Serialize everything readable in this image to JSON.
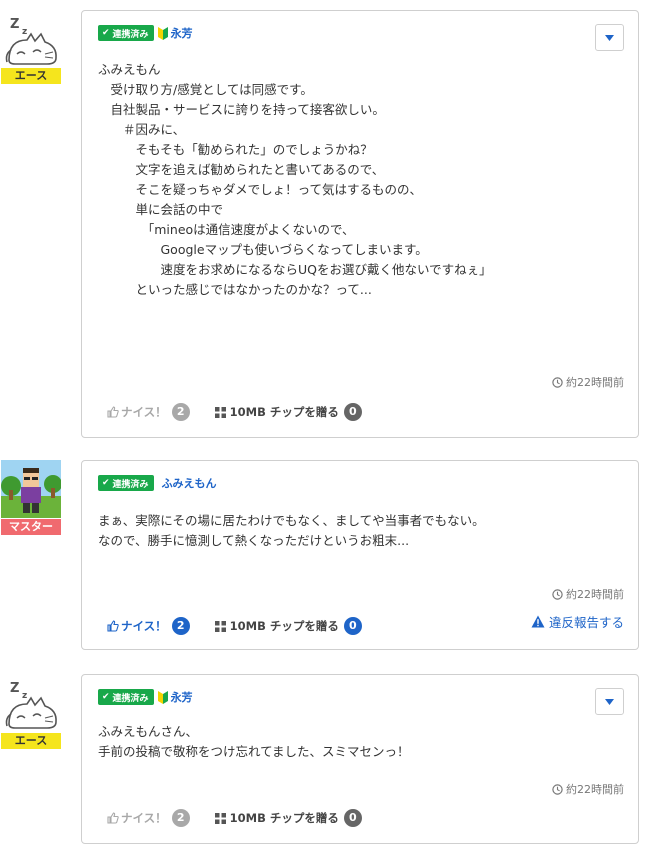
{
  "posts": [
    {
      "rank": "エース",
      "badge": "連携済み",
      "user": "永芳",
      "beginner_mark": true,
      "has_menu": true,
      "body": [
        "ふみえもん",
        "　受け取り方/感覚としては同感です。",
        "　自社製品・サービスに誇りを持って接客欲しい。",
        "",
        "　　＃因みに、",
        "　　　そもそも「勧められた」のでしょうかね？",
        "",
        "　　　文字を追えば勧められたと書いてあるので、",
        "　　　そこを疑っちゃダメでしょ！って気はするものの、",
        "",
        "　　　単に会話の中で",
        "　　　　「mineoは通信速度がよくないので、",
        "　　　　　Googleマップも使いづらくなってしまいます。",
        "　　　　　速度をお求めになるならUQをお選び戴く他ないですねぇ」",
        "　　　といった感じではなかったのかな？って..."
      ],
      "time": "約22時間前",
      "nice_label": "ナイス！",
      "nice_count": "2",
      "chip_label": "10MB チップを贈る",
      "chip_count": "0"
    },
    {
      "rank": "マスター",
      "badge": "連携済み",
      "user": "ふみえもん",
      "beginner_mark": false,
      "has_menu": false,
      "body": [
        "まぁ、実際にその場に居たわけでもなく、ましてや当事者でもない。",
        "",
        "なので、勝手に憶測して熱くなっただけというお粗末..."
      ],
      "time": "約22時間前",
      "nice_label": "ナイス！",
      "nice_count": "2",
      "chip_label": "10MB チップを贈る",
      "chip_count": "0",
      "report_label": "違反報告する"
    },
    {
      "rank": "エース",
      "badge": "連携済み",
      "user": "永芳",
      "beginner_mark": true,
      "has_menu": true,
      "body": [
        "ふみえもんさん、",
        "手前の投稿で敬称をつけ忘れてました、スミマセンっ！"
      ],
      "time": "約22時間前",
      "nice_label": "ナイス！",
      "nice_count": "2",
      "chip_label": "10MB チップを贈る",
      "chip_count": "0"
    }
  ],
  "colors": {
    "badge_green": "#18a84a",
    "link_blue": "#1e64c8",
    "rank_ace": "#f5e51d",
    "rank_master": "#f06a6f",
    "muted_gray": "#a8a8a8"
  }
}
